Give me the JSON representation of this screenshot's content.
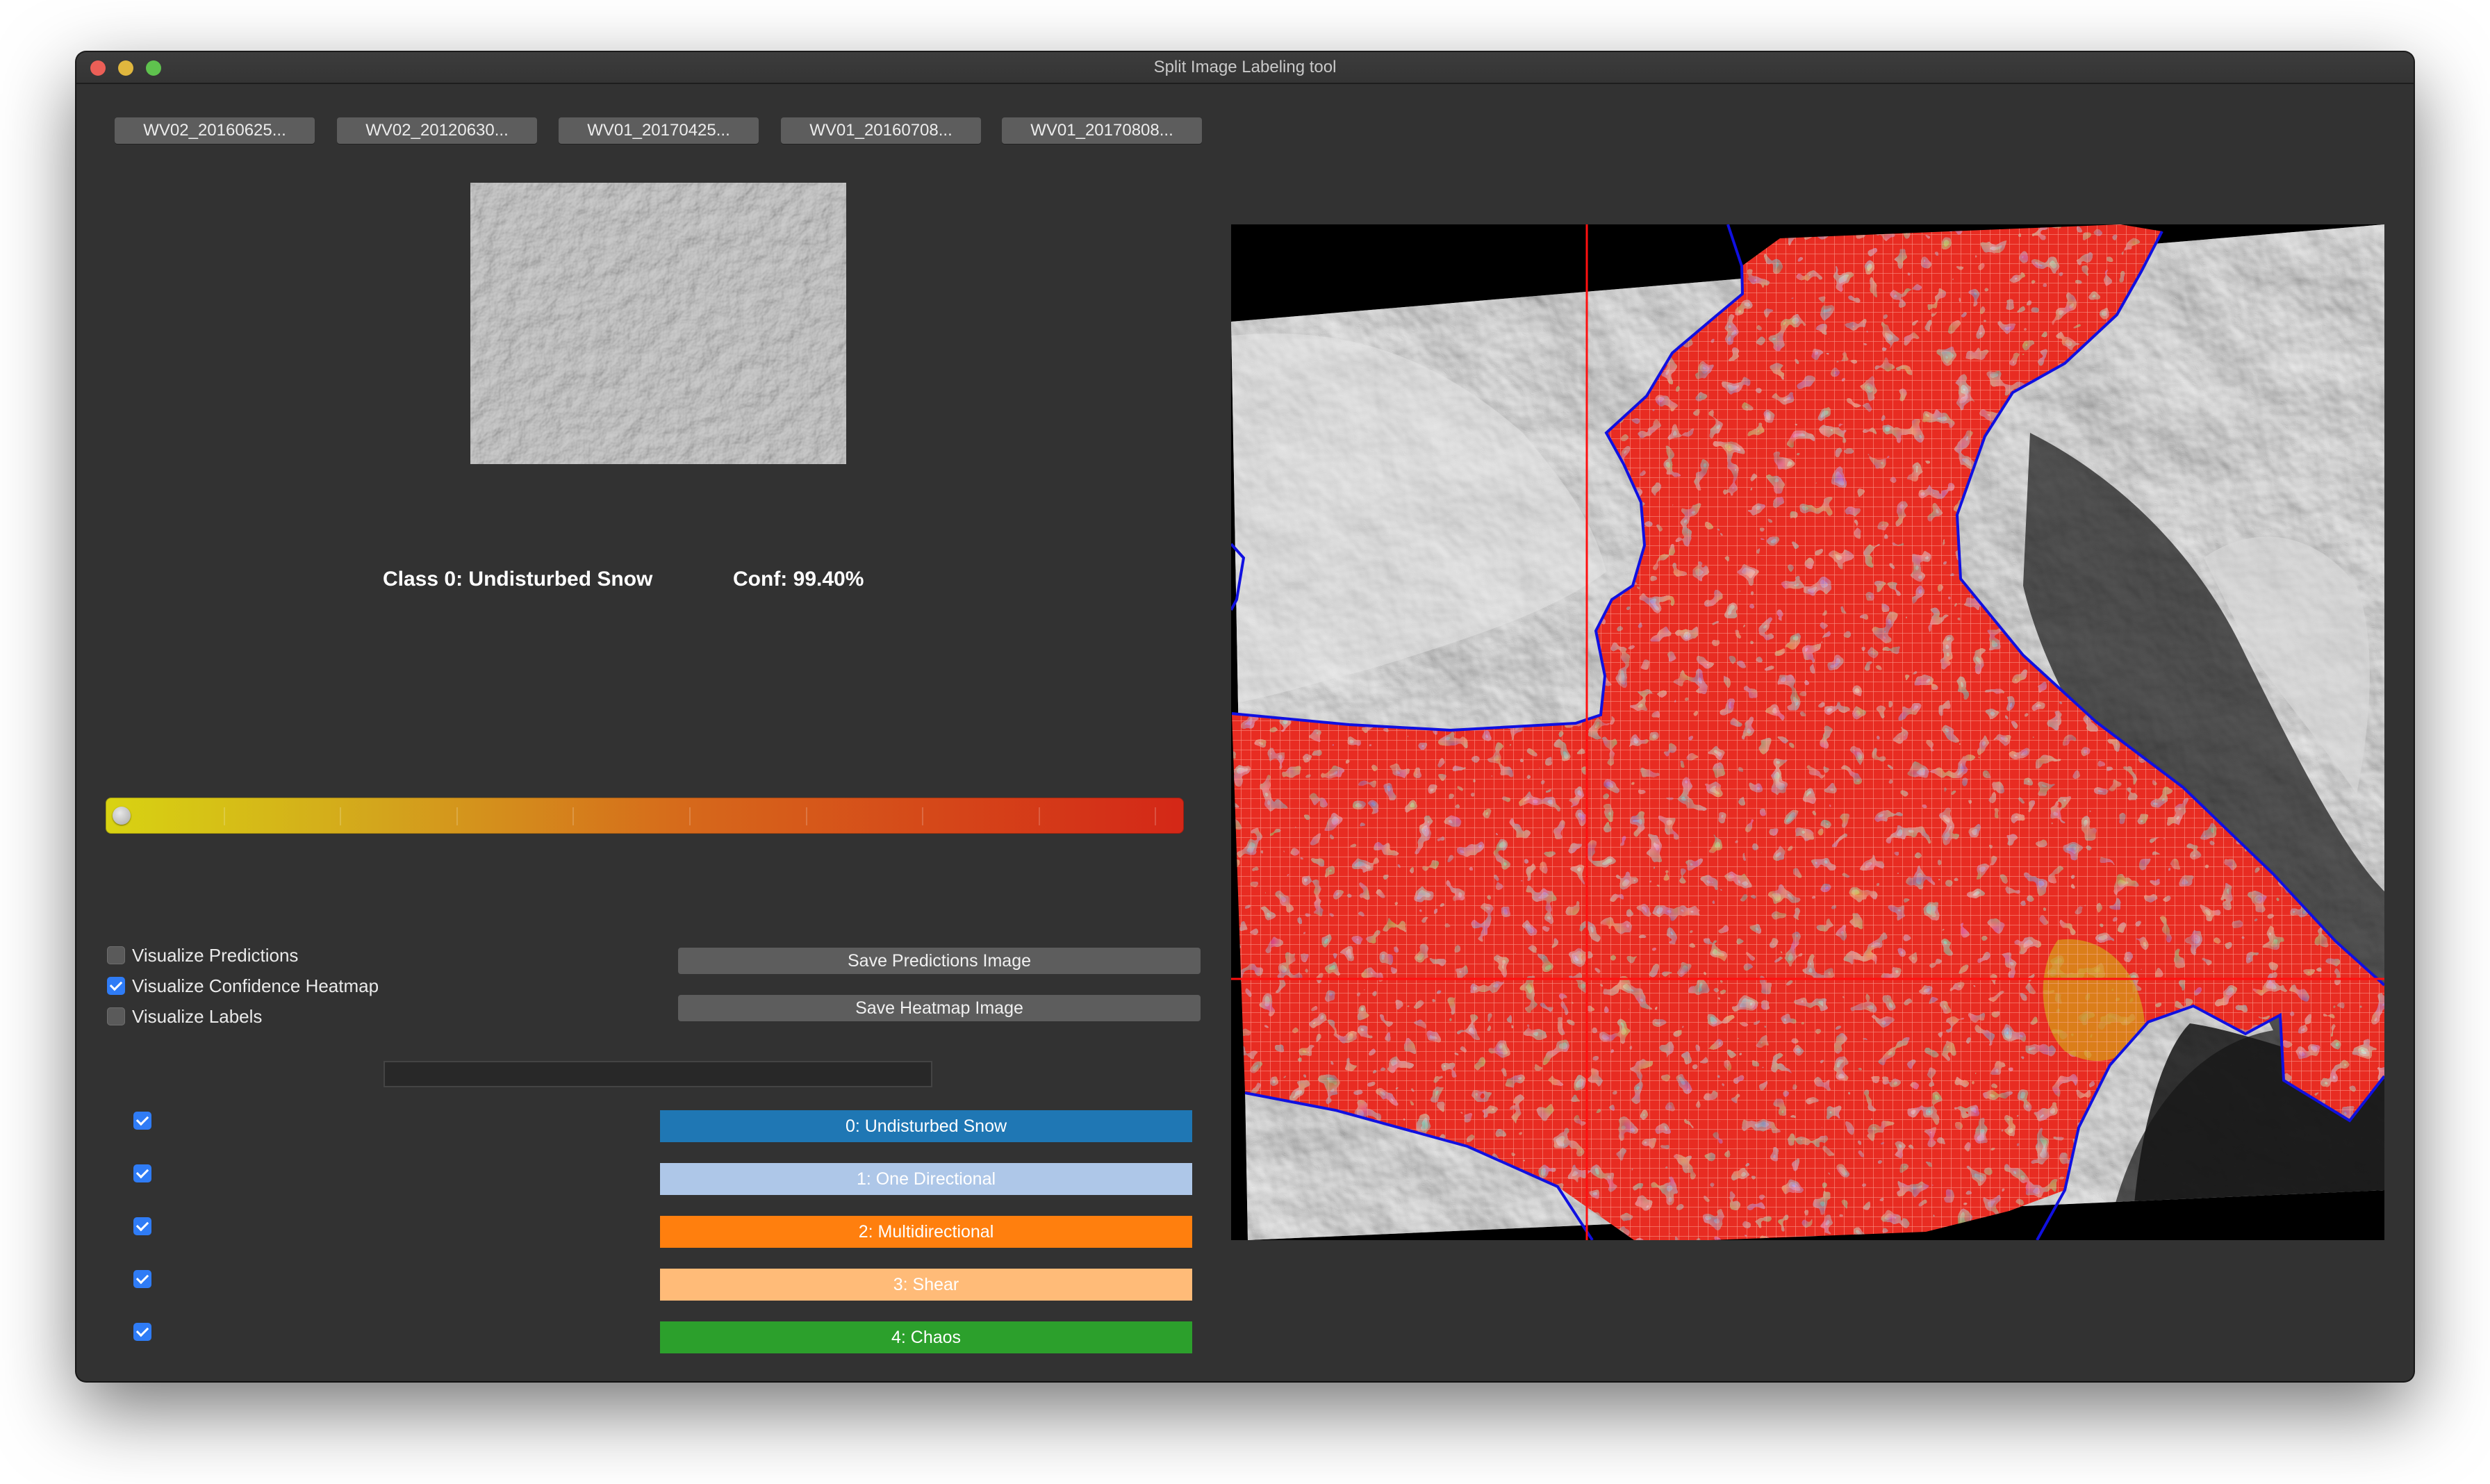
{
  "window": {
    "title": "Split Image Labeling tool"
  },
  "tabs": [
    {
      "label": "WV02_20160625..."
    },
    {
      "label": "WV02_20120630..."
    },
    {
      "label": "WV01_20170425..."
    },
    {
      "label": "WV01_20160708..."
    },
    {
      "label": "WV01_20170808..."
    }
  ],
  "prediction": {
    "class_text": "Class 0: Undisturbed Snow",
    "conf_text": "Conf: 99.40%"
  },
  "threshold_slider": {
    "value_fraction": 0.0
  },
  "visualize": {
    "predictions": {
      "label": "Visualize Predictions",
      "checked": false
    },
    "heatmap": {
      "label": "Visualize Confidence Heatmap",
      "checked": true
    },
    "labels": {
      "label": "Visualize Labels",
      "checked": false
    }
  },
  "buttons": {
    "save_predictions": "Save Predictions Image",
    "save_heatmap": "Save Heatmap Image"
  },
  "label_input": {
    "value": ""
  },
  "classes": [
    {
      "label": "0: Undisturbed Snow",
      "color": "#1f77b4",
      "checked": true
    },
    {
      "label": "1: One Directional",
      "color": "#aec7e8",
      "checked": true
    },
    {
      "label": "2: Multidirectional",
      "color": "#ff7f0e",
      "checked": true
    },
    {
      "label": "3: Shear",
      "color": "#ffbb78",
      "checked": true
    },
    {
      "label": "4: Chaos",
      "color": "#2ca02c",
      "checked": true
    }
  ],
  "colors": {
    "heatmap_low": "#d8d312",
    "heatmap_high": "#d42717",
    "boundary": "#1010e0",
    "crosshair": "#ff0000"
  }
}
